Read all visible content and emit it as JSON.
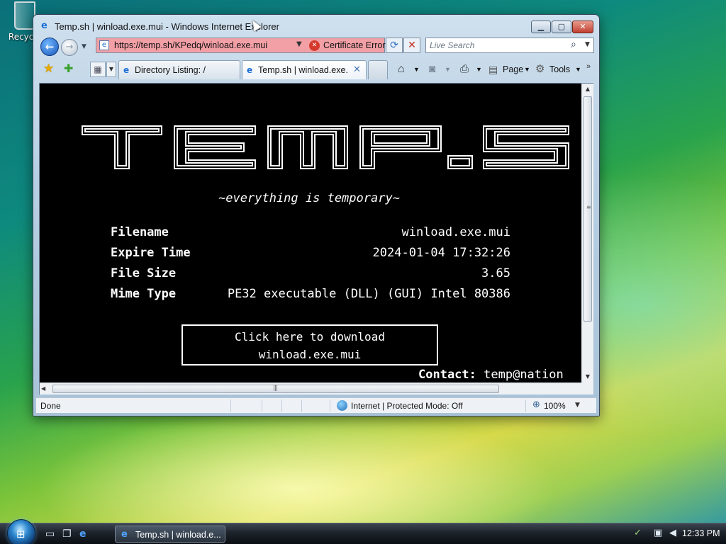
{
  "desktop": {
    "icons": [
      {
        "label": "Recycle",
        "icon": "recycle-bin-icon"
      }
    ]
  },
  "window": {
    "title": "Temp.sh | winload.exe.mui - Windows Internet Explorer",
    "controls": {
      "minimize": "▁",
      "maximize": "▢",
      "close": "✕"
    }
  },
  "address": {
    "url": "https://temp.sh/KPedq/winload.exe.mui",
    "cert_error": "Certificate Error",
    "highlight_color": "#f2a0a6"
  },
  "search": {
    "placeholder": "Live Search"
  },
  "tabs": [
    {
      "label": "Directory Listing: /",
      "active": false
    },
    {
      "label": "Temp.sh | winload.exe....",
      "active": true
    }
  ],
  "commands": {
    "page": "Page",
    "tools": "Tools"
  },
  "page": {
    "logo_text": "TEMP.S",
    "tagline": "~everything is temporary~",
    "info": [
      {
        "label": "Filename",
        "value": "winload.exe.mui"
      },
      {
        "label": "Expire Time",
        "value": "2024-01-04 17:32:26"
      },
      {
        "label": "File Size",
        "value": "3.65"
      },
      {
        "label": "Mime Type",
        "value": "PE32 executable (DLL) (GUI) Intel 80386"
      }
    ],
    "download": {
      "line1": "Click here to download",
      "line2": "winload.exe.mui"
    },
    "contact_label": "Contact:",
    "contact_value": "temp@nation"
  },
  "status": {
    "text": "Done",
    "zone": "Internet | Protected Mode: Off",
    "zoom": "100%"
  },
  "taskbar": {
    "task_label": "Temp.sh | winload.e...",
    "clock": "12:33 PM"
  }
}
